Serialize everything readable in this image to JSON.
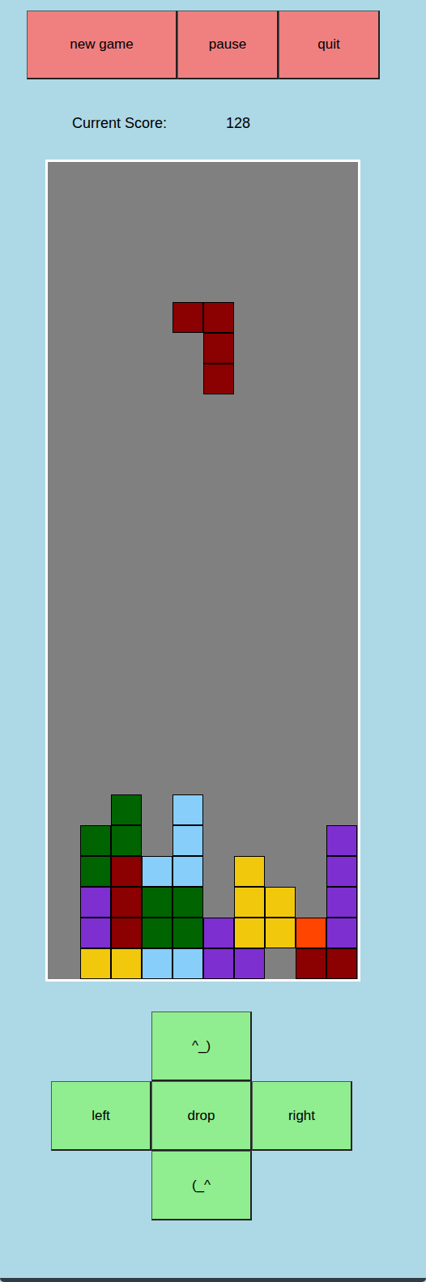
{
  "menu_buttons": [
    "new game",
    "pause",
    "quit"
  ],
  "score": {
    "label": "Current Score:",
    "value": "128"
  },
  "board": {
    "columns": 10,
    "stack_rows_bottom_up": [
      [
        "",
        "#f2c80c",
        "#f2c80c",
        "#87cefa",
        "#87cefa",
        "#7e2fd0",
        "#7e2fd0",
        "",
        "#8b0000",
        "#8b0000"
      ],
      [
        "",
        "#7e2fd0",
        "#8b0000",
        "#006400",
        "#006400",
        "#7e2fd0",
        "#f2c80c",
        "#f2c80c",
        "#ff4500",
        "#7e2fd0"
      ],
      [
        "",
        "#7e2fd0",
        "#8b0000",
        "#006400",
        "#006400",
        "",
        "#f2c80c",
        "#f2c80c",
        "",
        "#7e2fd0"
      ],
      [
        "",
        "#006400",
        "#8b0000",
        "#87cefa",
        "#87cefa",
        "",
        "#f2c80c",
        "",
        "",
        "#7e2fd0"
      ],
      [
        "",
        "#006400",
        "#006400",
        "",
        "#87cefa",
        "",
        "",
        "",
        "",
        "#7e2fd0"
      ],
      [
        "",
        "",
        "#006400",
        "",
        "#87cefa",
        "",
        "",
        "",
        "",
        ""
      ]
    ],
    "falling_piece": {
      "color": "#8b0000",
      "cells": [
        {
          "col": 4,
          "row": 21
        },
        {
          "col": 5,
          "row": 21
        },
        {
          "col": 5,
          "row": 20
        },
        {
          "col": 5,
          "row": 19
        }
      ]
    }
  },
  "controls": {
    "rotate_up": "^_)",
    "left": "left",
    "drop": "drop",
    "right": "right",
    "rotate_down": "(_^"
  }
}
